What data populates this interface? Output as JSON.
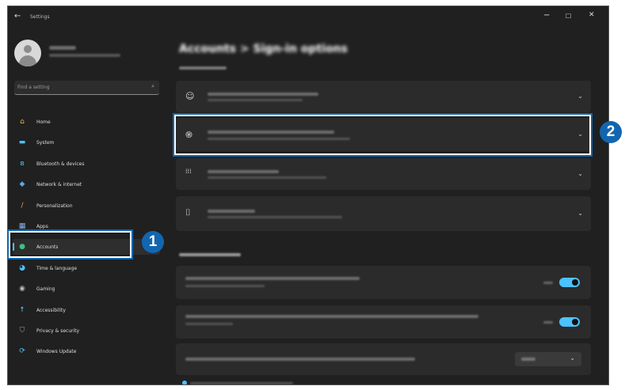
{
  "window": {
    "title": "Settings",
    "back_glyph": "←",
    "minimize_glyph": "−",
    "maximize_glyph": "☐",
    "close_glyph": "✕"
  },
  "search": {
    "placeholder": "Find a setting",
    "icon": "search-icon"
  },
  "sidebar": {
    "items": [
      {
        "label": "Home",
        "icon": "home-icon",
        "glyph": "⌂",
        "color": "#f2b84b"
      },
      {
        "label": "System",
        "icon": "monitor-icon",
        "glyph": "▬",
        "color": "#4cc2ff"
      },
      {
        "label": "Bluetooth & devices",
        "icon": "bluetooth-icon",
        "glyph": "ʙ",
        "color": "#4cc2ff"
      },
      {
        "label": "Network & internet",
        "icon": "wifi-icon",
        "glyph": "◆",
        "color": "#5aa8e8"
      },
      {
        "label": "Personalization",
        "icon": "brush-icon",
        "glyph": "/",
        "color": "#e0a050"
      },
      {
        "label": "Apps",
        "icon": "apps-icon",
        "glyph": "▦",
        "color": "#8ab4e8"
      },
      {
        "label": "Accounts",
        "icon": "person-icon",
        "glyph": "●",
        "color": "#3fbf7f",
        "selected": true
      },
      {
        "label": "Time & language",
        "icon": "globe-clock-icon",
        "glyph": "◕",
        "color": "#4cc2ff"
      },
      {
        "label": "Gaming",
        "icon": "gamepad-icon",
        "glyph": "◉",
        "color": "#bbbbbb"
      },
      {
        "label": "Accessibility",
        "icon": "accessibility-icon",
        "glyph": "☨",
        "color": "#4cc2ff"
      },
      {
        "label": "Privacy & security",
        "icon": "shield-icon",
        "glyph": "⛉",
        "color": "#9aa0a6"
      },
      {
        "label": "Windows Update",
        "icon": "update-icon",
        "glyph": "⟳",
        "color": "#4cc2ff"
      }
    ]
  },
  "main": {
    "title": "Accounts  >  Sign-in options",
    "cards": [
      {
        "icon": "face-icon",
        "glyph": "☺"
      },
      {
        "icon": "fingerprint-icon",
        "glyph": "֍"
      },
      {
        "icon": "pin-keypad-icon",
        "glyph": "⁞⁞⁞"
      },
      {
        "icon": "security-key-icon",
        "glyph": "⌷"
      }
    ],
    "settings": [
      {
        "control": "toggle",
        "state": "on"
      },
      {
        "control": "toggle",
        "state": "on"
      },
      {
        "control": "dropdown"
      }
    ]
  },
  "callouts": {
    "one": "1",
    "two": "2"
  },
  "colors": {
    "accent": "#4cc2ff",
    "callout": "#1266b0",
    "background": "#202020",
    "card": "#2b2b2b"
  }
}
